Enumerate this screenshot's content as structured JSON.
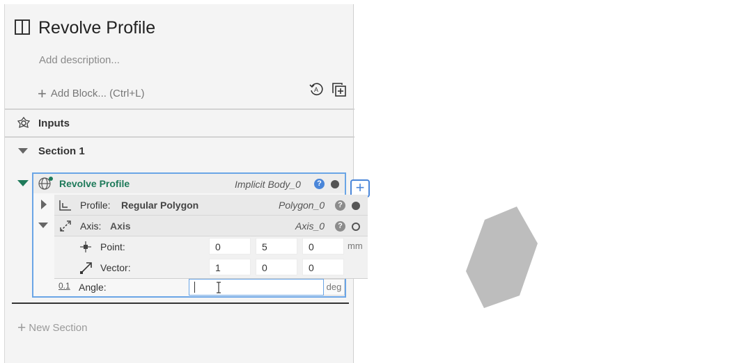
{
  "header": {
    "title": "Revolve Profile",
    "description_placeholder": "Add description...",
    "add_block_label": "Add Block... (Ctrl+L)"
  },
  "inputs": {
    "label": "Inputs"
  },
  "section": {
    "label": "Section 1"
  },
  "block": {
    "label": "Revolve Profile",
    "ref": "Implicit Body_0",
    "help": "?"
  },
  "profile": {
    "label": "Profile:",
    "value": "Regular Polygon",
    "ref": "Polygon_0",
    "help": "?"
  },
  "axis": {
    "label": "Axis:",
    "value": "Axis",
    "ref": "Axis_0",
    "help": "?",
    "point": {
      "label": "Point:",
      "x": "0",
      "y": "5",
      "z": "0",
      "unit": "mm"
    },
    "vector": {
      "label": "Vector:",
      "x": "1",
      "y": "0",
      "z": "0"
    }
  },
  "angle": {
    "prefix": "0.1",
    "label": "Angle:",
    "value": "",
    "unit": "deg"
  },
  "new_section_label": "New Section",
  "viewport": {
    "shape_color": "#bdbdbd"
  }
}
